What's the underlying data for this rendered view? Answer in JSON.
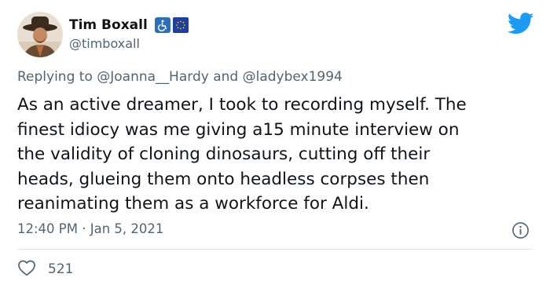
{
  "user": {
    "display_name": "Tim Boxall",
    "handle": "@timboxall",
    "badges": [
      "wheelchair-icon",
      "eu-flag-icon"
    ]
  },
  "reply": {
    "prefix": "Replying to ",
    "mention_1": "@Joanna__Hardy",
    "connector": " and ",
    "mention_2": "@ladybex1994"
  },
  "body": "As an active dreamer, I took to recording myself. The\nfinest idiocy was me giving a15 minute interview on\nthe validity of cloning dinosaurs, cutting off their\nheads, glueing them onto headless corpses then\nreanimating them as a workforce for Aldi.",
  "meta": {
    "timestamp": "12:40 PM · Jan 5, 2021"
  },
  "actions": {
    "like_count": "521"
  },
  "colors": {
    "twitter_blue": "#1d9bf0",
    "muted_text": "#536471",
    "primary_text": "#0f1419"
  }
}
